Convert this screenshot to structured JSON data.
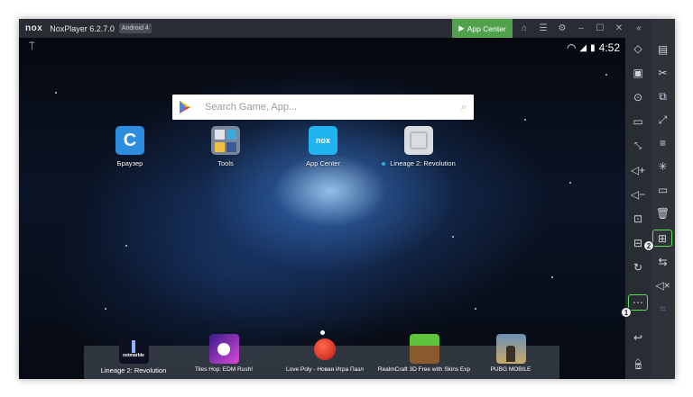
{
  "titlebar": {
    "logo": "nox",
    "app_name": "NoxPlayer 6.2.7.0",
    "android_badge": "Android 4",
    "app_center": "App Center"
  },
  "statusbar": {
    "time": "4:52"
  },
  "search": {
    "placeholder": "Search Game, App..."
  },
  "desktop_apps": [
    {
      "label": "Браузер"
    },
    {
      "label": "Tools"
    },
    {
      "label": "App Center"
    },
    {
      "label": "Lineage 2: Revolution"
    }
  ],
  "dock_apps": [
    {
      "label": "Lineage 2: Revolution",
      "tile_text": "netmarble"
    },
    {
      "label": "Tiles Hop: EDM Rush!"
    },
    {
      "label": "Love Poly - Новая Игра Пазл"
    },
    {
      "label": "RealmCraft 3D Free with Skins Exp"
    },
    {
      "label": "PUBG MOBILE"
    }
  ],
  "markers": {
    "first": "1",
    "second": "2"
  },
  "colors": {
    "accent_green": "#4fa24a",
    "highlight": "#5ee05a"
  }
}
